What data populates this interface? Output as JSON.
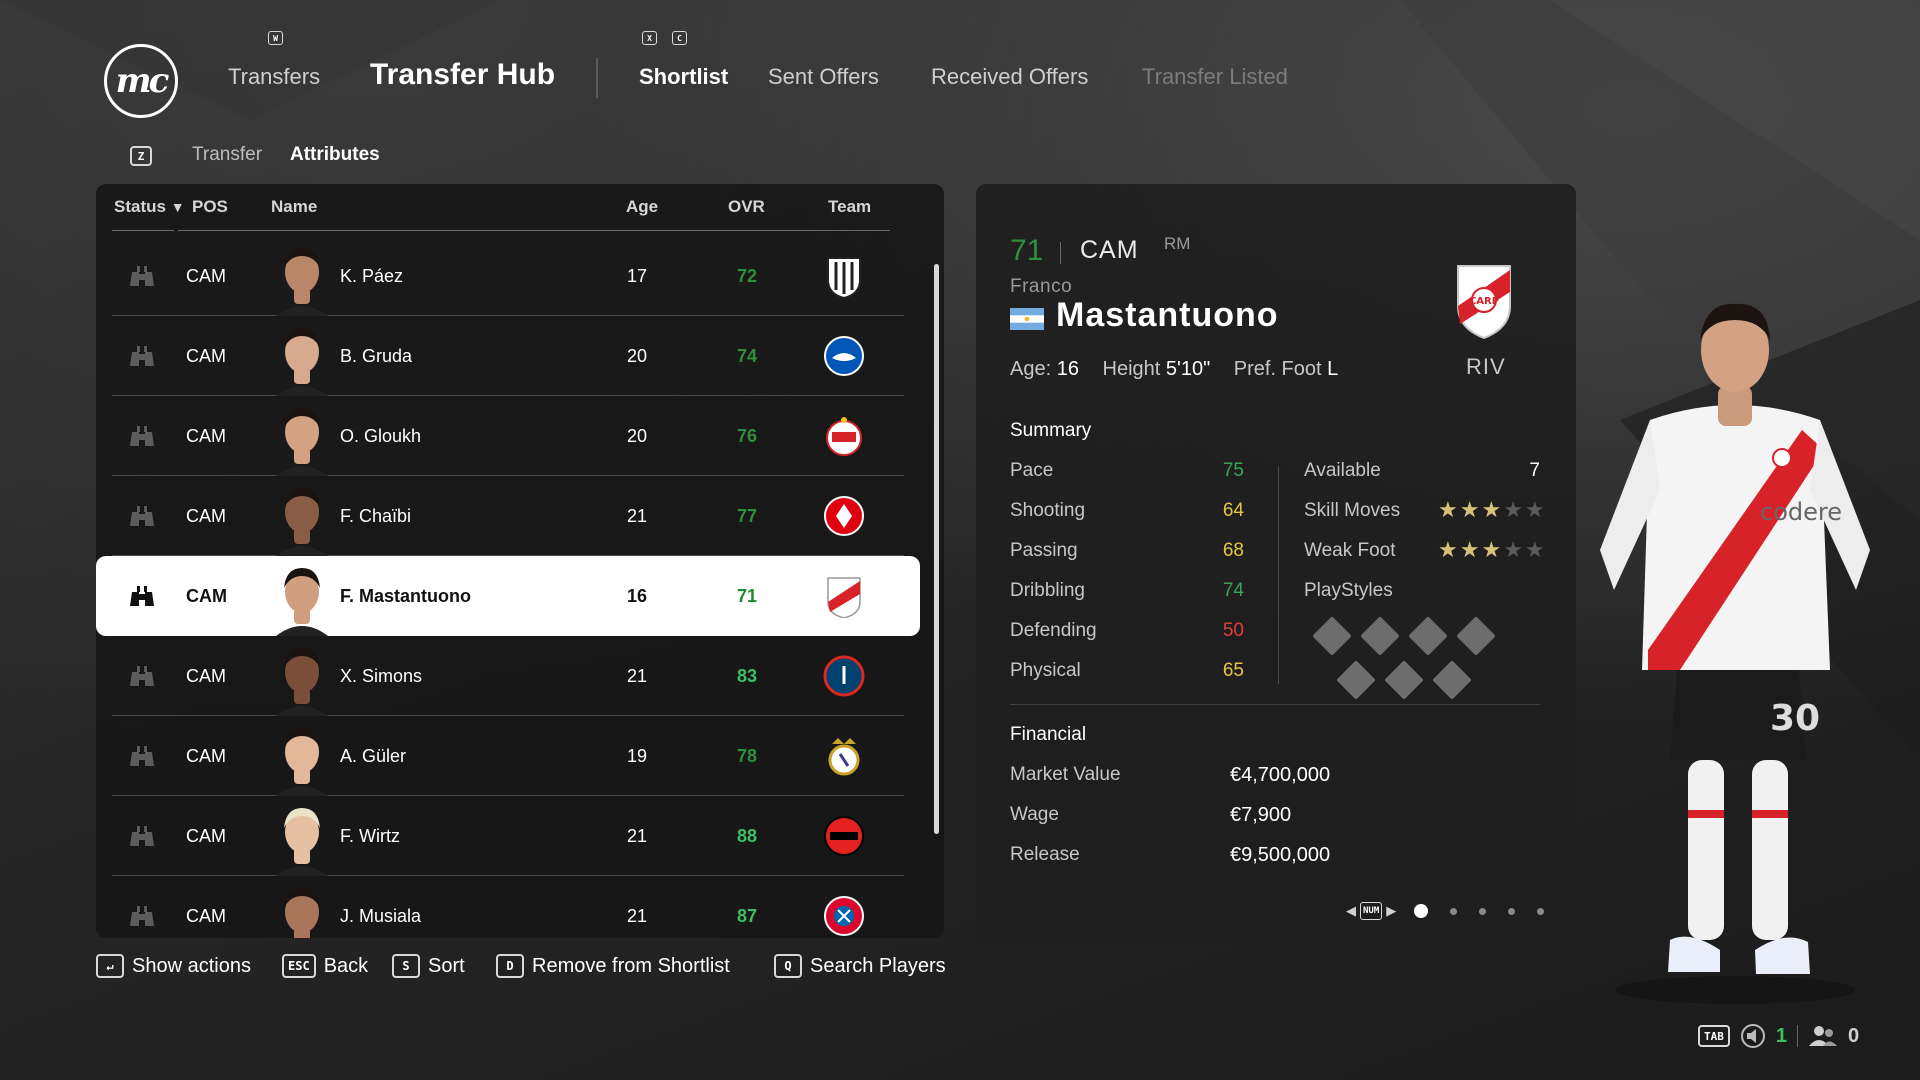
{
  "header": {
    "logo": "mc",
    "key_w": "W",
    "nav_transfers": "Transfers",
    "nav_hub": "Transfer Hub",
    "key_x": "X",
    "key_c": "C",
    "tabs": [
      {
        "label": "Shortlist",
        "state": "active"
      },
      {
        "label": "Sent Offers",
        "state": "normal"
      },
      {
        "label": "Received Offers",
        "state": "normal"
      },
      {
        "label": "Transfer Listed",
        "state": "disabled"
      }
    ]
  },
  "subnav": {
    "key": "Z",
    "items": [
      {
        "label": "Transfer",
        "state": "off"
      },
      {
        "label": "Attributes",
        "state": "on"
      }
    ]
  },
  "list": {
    "columns": {
      "status": "Status",
      "pos": "POS",
      "name": "Name",
      "age": "Age",
      "ovr": "OVR",
      "team": "Team"
    },
    "sort_indicator": "▼",
    "players": [
      {
        "pos": "CAM",
        "name": "K. Páez",
        "age": "17",
        "ovr": "72",
        "ovr_color": "#2f8f3a",
        "crest": "independiente-crest",
        "selected": false
      },
      {
        "pos": "CAM",
        "name": "B. Gruda",
        "age": "20",
        "ovr": "74",
        "ovr_color": "#2f8f3a",
        "crest": "brighton-crest",
        "selected": false
      },
      {
        "pos": "CAM",
        "name": "O. Gloukh",
        "age": "20",
        "ovr": "76",
        "ovr_color": "#2f8f3a",
        "crest": "salzburg-crest",
        "selected": false
      },
      {
        "pos": "CAM",
        "name": "F. Chaïbi",
        "age": "21",
        "ovr": "77",
        "ovr_color": "#2f8f3a",
        "crest": "frankfurt-crest",
        "selected": false
      },
      {
        "pos": "CAM",
        "name": "F. Mastantuono",
        "age": "16",
        "ovr": "71",
        "ovr_color": "#1e8a2e",
        "crest": "river-plate-crest",
        "selected": true
      },
      {
        "pos": "CAM",
        "name": "X. Simons",
        "age": "21",
        "ovr": "83",
        "ovr_color": "#3cc063",
        "crest": "psg-crest",
        "selected": false
      },
      {
        "pos": "CAM",
        "name": "A. Güler",
        "age": "19",
        "ovr": "78",
        "ovr_color": "#2f8f3a",
        "crest": "real-madrid-crest",
        "selected": false
      },
      {
        "pos": "CAM",
        "name": "F. Wirtz",
        "age": "21",
        "ovr": "88",
        "ovr_color": "#3cc063",
        "crest": "leverkusen-crest",
        "selected": false
      },
      {
        "pos": "CAM",
        "name": "J. Musiala",
        "age": "21",
        "ovr": "87",
        "ovr_color": "#3cc063",
        "crest": "bayern-crest",
        "selected": false
      }
    ]
  },
  "detail": {
    "ovr": "71",
    "position": "CAM",
    "alt_position": "RM",
    "first_name": "Franco",
    "last_name": "Mastantuono",
    "nationality_flag": "argentina-flag",
    "age_label": "Age:",
    "age": "16",
    "height_label": "Height",
    "height": "5'10\"",
    "foot_label": "Pref. Foot",
    "foot": "L",
    "club_abbr": "RIV",
    "summary_title": "Summary",
    "stats": [
      {
        "label": "Pace",
        "value": "75",
        "cls": "v-green"
      },
      {
        "label": "Shooting",
        "value": "64",
        "cls": "v-yellow"
      },
      {
        "label": "Passing",
        "value": "68",
        "cls": "v-yellow"
      },
      {
        "label": "Dribbling",
        "value": "74",
        "cls": "v-green"
      },
      {
        "label": "Defending",
        "value": "50",
        "cls": "v-red"
      },
      {
        "label": "Physical",
        "value": "65",
        "cls": "v-yellow"
      }
    ],
    "available_label": "Available",
    "available": "7",
    "skill_moves_label": "Skill Moves",
    "skill_moves": 3,
    "weak_foot_label": "Weak Foot",
    "weak_foot": 3,
    "stars_max": 5,
    "playstyles_label": "PlayStyles",
    "financial_title": "Financial",
    "financial": [
      {
        "label": "Market Value",
        "value": "€4,700,000"
      },
      {
        "label": "Wage",
        "value": "€7,900"
      },
      {
        "label": "Release",
        "value": "€9,500,000"
      }
    ],
    "pager_key": "NUM",
    "pager_pages": 5,
    "pager_current": 1
  },
  "footer": {
    "actions": [
      {
        "key": "↵",
        "label": "Show actions"
      },
      {
        "key": "ESC",
        "label": "Back"
      },
      {
        "key": "S",
        "label": "Sort"
      },
      {
        "key": "D",
        "label": "Remove from Shortlist"
      },
      {
        "key": "Q",
        "label": "Search Players"
      }
    ],
    "status_key": "TAB",
    "voice_count": "1",
    "users_count": "0"
  },
  "colors": {
    "accent_green": "#3cc063",
    "rating_green": "#2f8f3a",
    "stat_yellow": "#e3c640",
    "stat_red": "#e23c3c",
    "star_gold": "#d8c27a",
    "river_red": "#d8222a"
  }
}
